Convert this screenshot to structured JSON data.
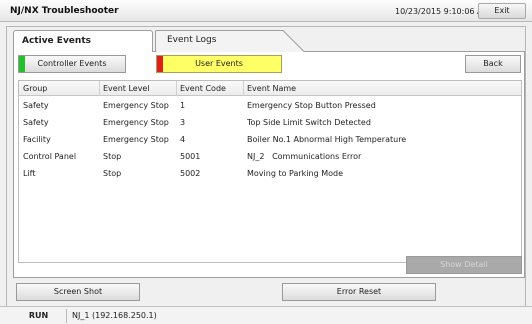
{
  "app": {
    "title": "NJ/NX Troubleshooter",
    "datetime": "10/23/2015 9:10:06 AM",
    "exit_label": "Exit"
  },
  "tabs": [
    {
      "label": "Active Events",
      "active": true
    },
    {
      "label": "Event Logs",
      "active": false
    }
  ],
  "toolbar": {
    "controller_events_label": "Controller Events",
    "user_events_label": "User Events",
    "back_label": "Back"
  },
  "colors": {
    "controller_indicator": "#22c12a",
    "user_indicator": "#dd1f1f",
    "user_events_bg": "#ffff66"
  },
  "table": {
    "columns": [
      "Group",
      "Event Level",
      "Event Code",
      "Event Name"
    ],
    "rows": [
      [
        "Safety",
        "Emergency Stop",
        "1",
        "Emergency Stop Button Pressed"
      ],
      [
        "Safety",
        "Emergency Stop",
        "3",
        "Top Side Limit Switch Detected"
      ],
      [
        "Facility",
        "Emergency Stop",
        "4",
        "Boiler No.1 Abnormal High Temperature"
      ],
      [
        "Control Panel",
        "Stop",
        "5001",
        "NJ_2   Communications Error"
      ],
      [
        "Lift",
        "Stop",
        "5002",
        "Moving to Parking Mode"
      ]
    ]
  },
  "actions": {
    "show_detail_label": "Show Detail",
    "screen_shot_label": "Screen Shot",
    "error_reset_label": "Error Reset"
  },
  "status": {
    "mode": "RUN",
    "connection": "NJ_1 (192.168.250.1)"
  }
}
